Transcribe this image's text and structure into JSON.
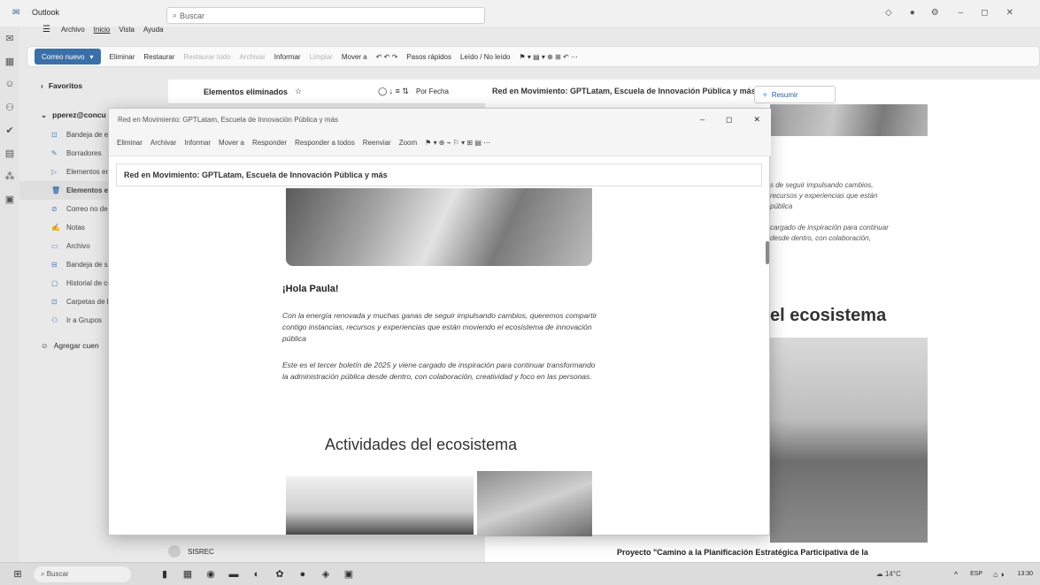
{
  "window": {
    "app_title": "Outlook",
    "search_placeholder": "Buscar"
  },
  "menu": [
    "Archivo",
    "Inicio",
    "Vista",
    "Ayuda"
  ],
  "ribbon": {
    "new_mail": "Correo nuevo",
    "items": [
      "Eliminar",
      "Restaurar",
      "Restaurar todo",
      "Archivar",
      "Informar",
      "Limpiar",
      "Mover a",
      "Pasos rápidos",
      "Leído / No leído"
    ]
  },
  "folders": {
    "favorites": "Favoritos",
    "account": "pperez@concu",
    "items": [
      "Bandeja de en",
      "Borradores",
      "Elementos en",
      "Elementos eli",
      "Correo no des",
      "Notas",
      "Archivo",
      "Bandeja de sa",
      "Historial de co",
      "Carpetas de b",
      "Ir a Grupos"
    ],
    "add_account": "Agregar cuen"
  },
  "message_list": {
    "title": "Elementos eliminados",
    "sort": "Por Fecha",
    "sender": "SISREC"
  },
  "reading_pane": {
    "subject": "Red en Movimiento: GPTLatam, Escuela de Innovación Pública y más",
    "summarize": "Resumir",
    "text_lines": [
      "s de seguir impulsando cambios,",
      "recursos y experiencias que están",
      "pública",
      "cargado de inspiración para continuar",
      "desde dentro, con colaboración,"
    ],
    "heading": "el ecosistema",
    "caption": "Proyecto \"Camino a la Planificación Estratégica Participativa de la"
  },
  "popup": {
    "title": "Red en Movimiento: GPTLatam, Escuela de Innovación Pública y más",
    "toolbar": [
      "Eliminar",
      "Archivar",
      "Informar",
      "Mover a",
      "Responder",
      "Responder a todos",
      "Reenviar",
      "Zoom"
    ],
    "subject": "Red en Movimiento: GPTLatam, Escuela de Innovación Pública y más",
    "greeting": "¡Hola Paula!",
    "paragraph1": "Con la energía renovada y muchas ganas de seguir impulsando cambios, queremos compartir contigo instancias, recursos y experiencias que están moviendo el ecosistema de innovación pública",
    "paragraph2": "Este es el tercer boletín de 2025 y viene cargado de inspiración para continuar transformando la administración pública desde dentro, con colaboración, creatividad y foco en las personas.",
    "section_heading": "Actividades del ecosistema"
  },
  "taskbar": {
    "search": "Buscar",
    "weather": "14°C",
    "lang": "ESP",
    "time": "13:30"
  }
}
